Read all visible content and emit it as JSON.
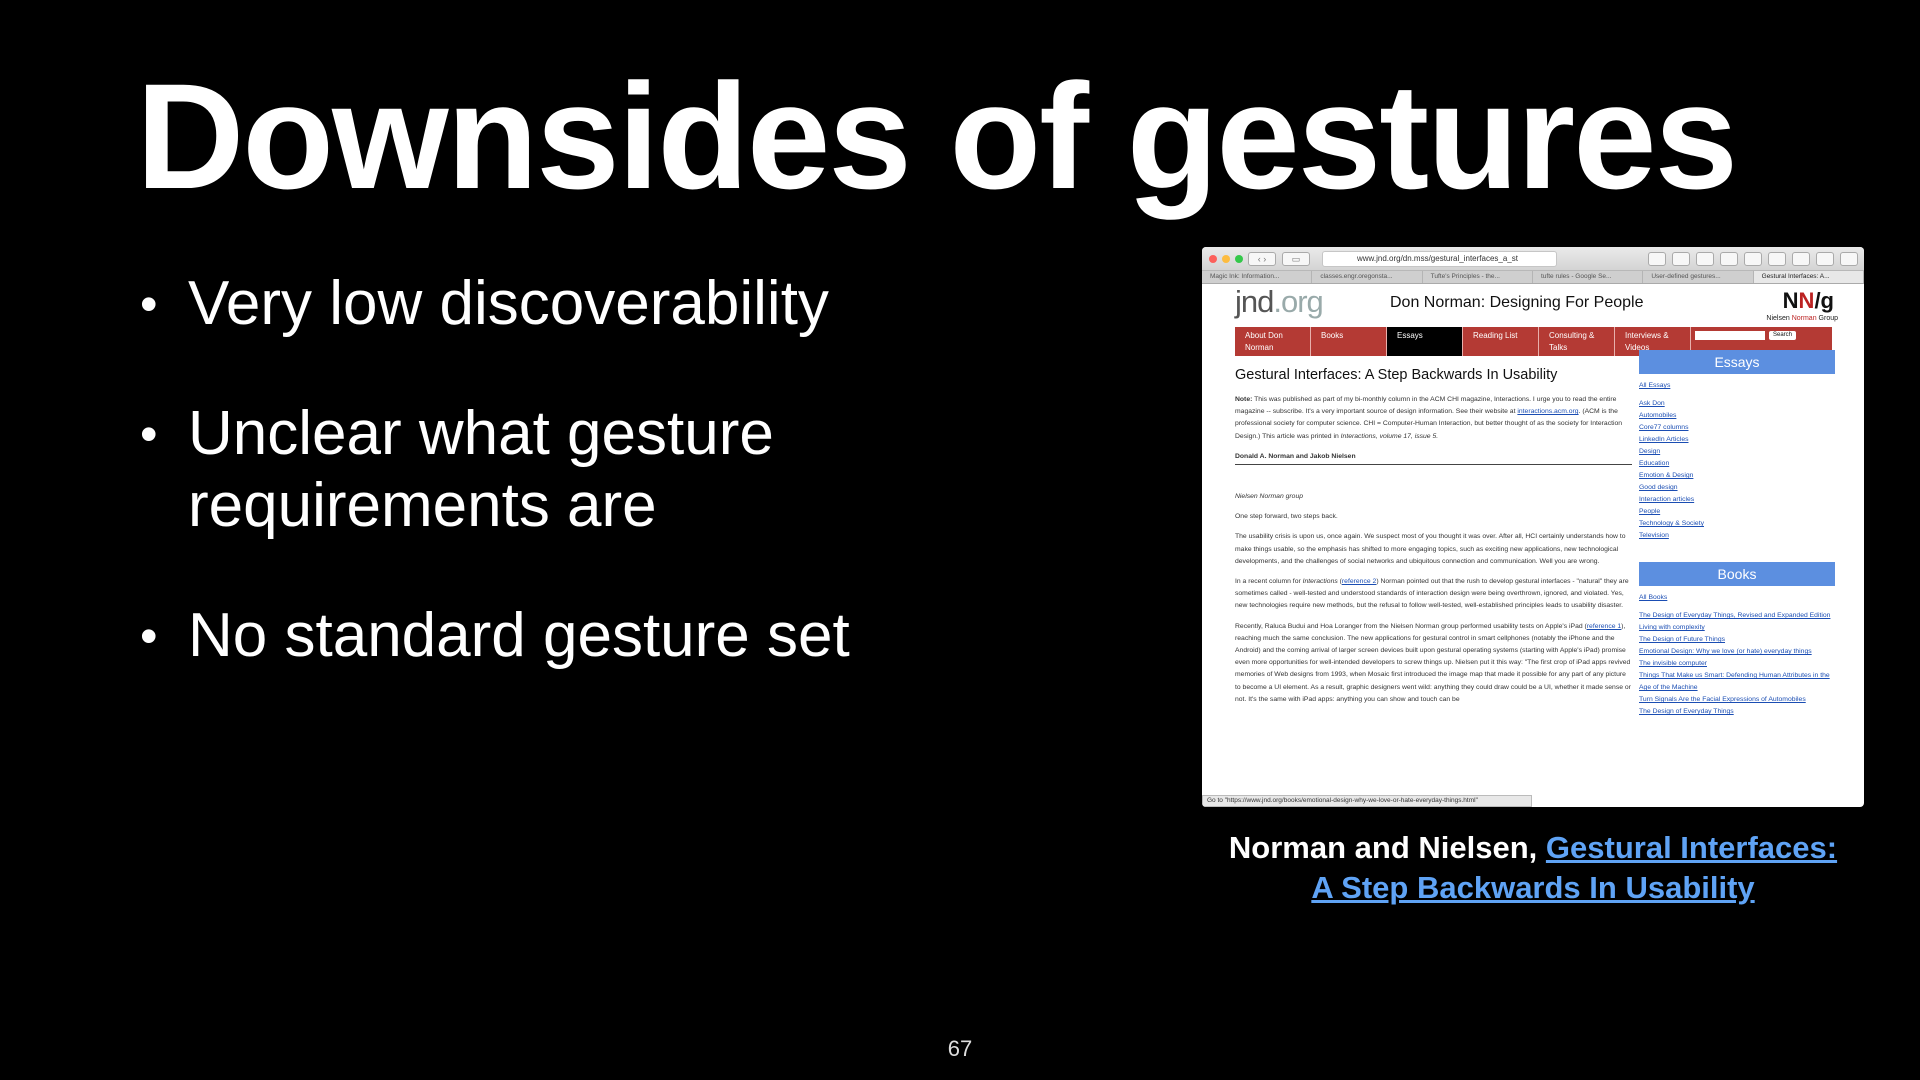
{
  "slide": {
    "title": "Downsides of gestures",
    "bullets": [
      "Very low discoverability",
      "Unclear what gesture requirements are",
      "No standard gesture set"
    ],
    "bullet_glyph": "•",
    "page_number": "67"
  },
  "caption": {
    "authors": "Norman and Nielsen,",
    "link_line1": "Gestural Interfaces:",
    "link_line2": "A Step Backwards In Usability",
    "link_color": "#5fa3f5"
  },
  "browser": {
    "url": "www.jnd.org/dn.mss/gestural_interfaces_a_st",
    "tabs": [
      "Magic Ink: Information...",
      "classes.engr.oregonsta...",
      "Tufte's Principles - the...",
      "tufte rules - Google Se...",
      "User-defined gestures...",
      "Gestural Interfaces: A..."
    ],
    "status_text": "Go to \"https://www.jnd.org/books/emotional-design-why-we-love-or-hate-everyday-things.html\""
  },
  "site": {
    "logo_main": "jnd",
    "logo_suffix": ".org",
    "tagline": "Don Norman: Designing For People",
    "nng_n1": "N",
    "nng_n2": "N",
    "nng_g": "/g",
    "nng_sub_pre": "Nielsen ",
    "nng_sub_norman": "Norman",
    "nng_sub_post": " Group",
    "menu": [
      "About Don Norman",
      "Books",
      "Essays",
      "Reading List",
      "Consulting & Talks",
      "Interviews & Videos"
    ],
    "search_button": "Search",
    "accent_color": "#b43a34"
  },
  "article": {
    "title": "Gestural Interfaces: A Step Backwards In Usability",
    "note_label": "Note:",
    "note_text": " This was published as part of my bi-monthly column in the ACM CHI magazine, Interactions. I urge you to read the entire magazine -- subscribe. It's a very important source of design information. See their website at ",
    "note_link": "interactions.acm.org",
    "note_text2": ". (ACM is the professional society for computer science. CHI = Computer-Human Interaction, but better thought of as the society for Interaction Design.) This article was printed in ",
    "note_italic": "Interactions, volume 17, issue 5.",
    "byline": "Donald A. Norman and Jakob Nielsen",
    "group": "Nielsen Norman group",
    "p1": "One step forward, two steps back.",
    "p2": "The usability crisis is upon us, once again. We suspect most of you thought it was over. After all, HCI certainly understands how to make things usable, so the emphasis has shifted to more engaging topics, such as exciting new applications, new technological developments, and the challenges of social networks and ubiquitous connection and communication. Well you are wrong.",
    "p3a": "In a recent column for ",
    "p3_italic": "Interactions",
    "p3b": " (",
    "p3_link": "reference 2",
    "p3c": ") Norman pointed out that the rush to develop gestural interfaces - \"natural\" they are sometimes called - well-tested and understood standards of interaction design were being overthrown, ignored, and violated. Yes, new technologies require new methods, but the refusal to follow well-tested, well-established principles leads to usability disaster.",
    "p4a": "Recently, Raluca Budui and Hoa Loranger from the Nielsen Norman group performed usability tests on Apple's iPad (",
    "p4_link": "reference 1",
    "p4b": "), reaching much the same conclusion. The new applications for gestural control in smart cellphones (notably the iPhone and the Android) and the coming arrival of larger screen devices built upon gestural operating systems (starting with Apple's iPad) promise even more opportunities for well-intended developers to screw things up. Nielsen put it this way: \"The first crop of iPad apps revived memories of Web designs from 1993, when Mosaic first introduced the image map that made it possible for any part of any picture to become a UI element. As a result, graphic designers went wild: anything they could draw could be a UI, whether it made sense or not. It's the same with iPad apps: anything you can show and touch can be"
  },
  "sidebar": {
    "essays_heading": "Essays",
    "essays_all": "All Essays",
    "essays_links": [
      "Ask Don",
      "Automobiles",
      "Core77 columns",
      "LinkedIn Articles",
      "Design",
      "Education",
      "Emotion & Design",
      "Good design",
      "Interaction articles",
      "People",
      "Technology & Society",
      "Television"
    ],
    "books_heading": "Books",
    "books_all": "All Books",
    "books_links": [
      "The Design of Everyday Things, Revised and Expanded Edition",
      "Living with complexity",
      "The Design of Future Things",
      "Emotional Design: Why we love (or hate) everyday things",
      "The invisible computer",
      "Things That Make us Smart: Defending Human Attributes in the Age of the Machine",
      "Turn Signals Are the Facial Expressions of Automobiles",
      "The Design of Everyday Things"
    ],
    "heading_color": "#5c8fe0"
  }
}
